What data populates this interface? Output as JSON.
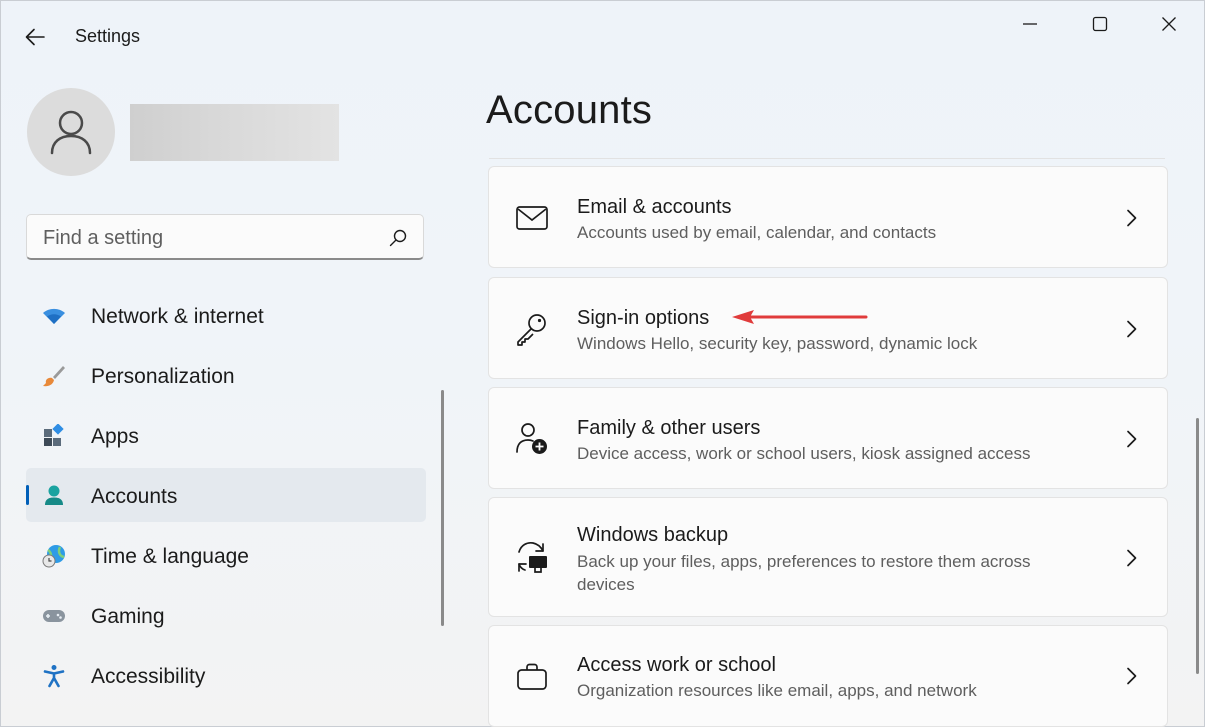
{
  "window": {
    "title": "Settings",
    "controls": [
      "minimize",
      "maximize",
      "close"
    ]
  },
  "user": {
    "name_redacted": true
  },
  "search": {
    "placeholder": "Find a setting",
    "value": ""
  },
  "nav": {
    "items": [
      {
        "label": "Network & internet",
        "icon": "wifi-icon",
        "active": false
      },
      {
        "label": "Personalization",
        "icon": "paintbrush-icon",
        "active": false
      },
      {
        "label": "Apps",
        "icon": "apps-icon",
        "active": false
      },
      {
        "label": "Accounts",
        "icon": "accounts-icon",
        "active": true
      },
      {
        "label": "Time & language",
        "icon": "globe-clock-icon",
        "active": false
      },
      {
        "label": "Gaming",
        "icon": "gamepad-icon",
        "active": false
      },
      {
        "label": "Accessibility",
        "icon": "accessibility-icon",
        "active": false
      }
    ]
  },
  "main": {
    "title": "Accounts",
    "cards": [
      {
        "title": "Email & accounts",
        "desc": "Accounts used by email, calendar, and contacts",
        "icon": "mail-icon"
      },
      {
        "title": "Sign-in options",
        "desc": "Windows Hello, security key, password, dynamic lock",
        "icon": "key-icon"
      },
      {
        "title": "Family & other users",
        "desc": "Device access, work or school users, kiosk assigned access",
        "icon": "add-user-icon"
      },
      {
        "title": "Windows backup",
        "desc": "Back up your files, apps, preferences to restore them across devices",
        "icon": "backup-icon"
      },
      {
        "title": "Access work or school",
        "desc": "Organization resources like email, apps, and network",
        "icon": "briefcase-icon"
      }
    ]
  },
  "colors": {
    "accent": "#005fb8",
    "annotation_arrow": "#e03b3b"
  }
}
